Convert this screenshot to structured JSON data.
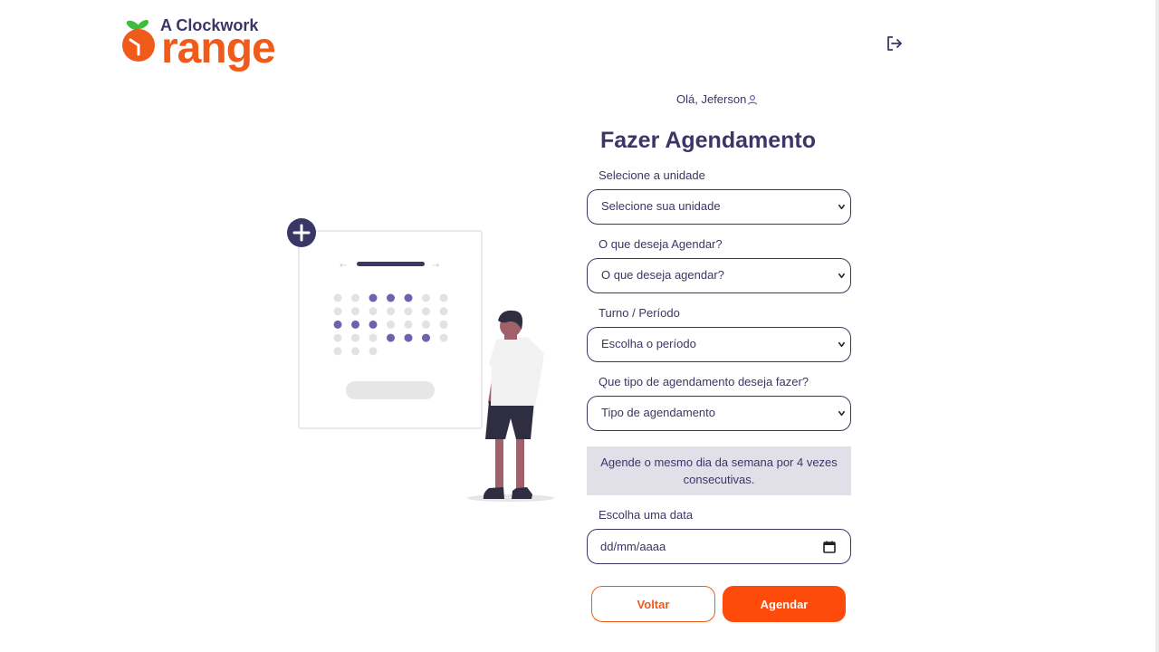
{
  "header": {
    "logo_small": "A Clockwork",
    "logo_big": "range",
    "logout_icon": "logout-icon"
  },
  "greeting": {
    "text": "Olá, Jeferson",
    "icon": "user-icon"
  },
  "form": {
    "title": "Fazer Agendamento",
    "unidade": {
      "label": "Selecione a unidade",
      "value": "Selecione sua unidade"
    },
    "agendar_o_que": {
      "label": "O que deseja Agendar?",
      "value": "O que deseja agendar?"
    },
    "turno": {
      "label": "Turno / Período",
      "value": "Escolha o período"
    },
    "tipo": {
      "label": "Que tipo de agendamento deseja fazer?",
      "value": "Tipo de agendamento"
    },
    "notice": "Agende o mesmo dia da semana por 4 vezes consecutivas.",
    "data": {
      "label": "Escolha uma data",
      "placeholder": "dd/mm/aaaa"
    },
    "buttons": {
      "voltar": "Voltar",
      "agendar": "Agendar"
    }
  },
  "colors": {
    "brand_orange": "#fe4a0b",
    "brand_navy": "#3a3666",
    "notice_bg": "#e1e0e9",
    "accent_purple": "#6c63ac"
  }
}
